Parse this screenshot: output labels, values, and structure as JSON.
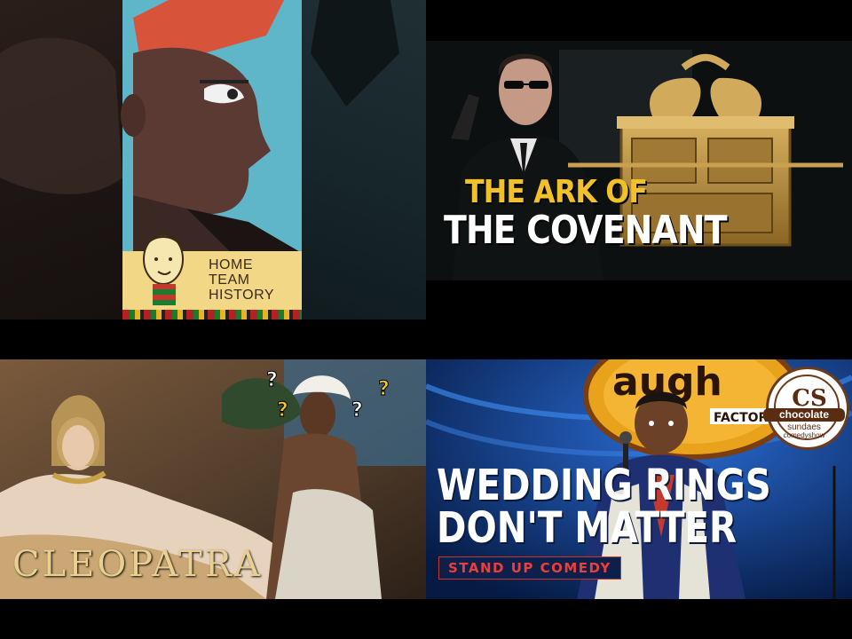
{
  "thumbnails": [
    {
      "logo_lines": [
        "HOME",
        "TEAM",
        "HISTORY"
      ]
    },
    {
      "title_line1": "THE ARK OF",
      "title_line2": "THE COVENANT"
    },
    {
      "title": "CLEOPATRA",
      "question_marks": [
        "?",
        "?",
        "?",
        "?"
      ]
    },
    {
      "title_line1": "WEDDING RINGS",
      "title_line2": "DON'T MATTER",
      "badge": "STAND UP COMEDY",
      "logo_letters": "CS",
      "logo_word1": "chocolate",
      "logo_word2": "sundaes",
      "logo_word3": "comedyshow"
    }
  ],
  "colors": {
    "background": "#000000",
    "ark_title_gold": "#f0c12a",
    "cleopatra_gold": "#e9cf92",
    "comedy_badge_red": "#e9413a"
  }
}
